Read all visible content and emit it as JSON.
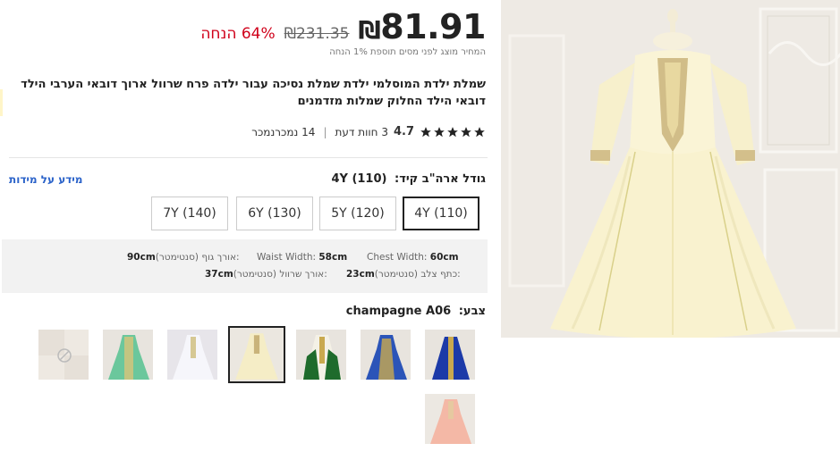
{
  "price": {
    "current": "81.91",
    "currency": "₪",
    "original": "₪231.35",
    "discount": "64% הנחה",
    "tax_note": "המחיר מוצג לפני מסים תוספת 1% הנחה"
  },
  "product": {
    "title": "שמלת ילדת המוסלמי ילדת שמלת נסיכה עבור ילדה פרח שרוול ארוך דובאי הערבי הילד דובאי הילד החלוק שמלות מזדמנים"
  },
  "rating": {
    "score": "4.7",
    "reviews": "3 חוות דעת",
    "sold": "14 נמכרנמכר",
    "stars": 5
  },
  "size": {
    "label": "גודל ארה\"ב קיד:",
    "selected": "4Y (110)",
    "info_link": "מידע על מידות",
    "options": [
      "4Y (110)",
      "5Y (120)",
      "6Y (130)",
      "7Y (140)"
    ]
  },
  "measurements": {
    "chest_label": "Chest Width:",
    "chest_value": "60cm",
    "waist_label": "Waist Width:",
    "waist_value": "58cm",
    "body_length_label": "אורך גוף (סנטימטר):",
    "body_length_value": "90cm",
    "shoulder_label": "כתף צלב (סנטימטר):",
    "shoulder_value": "23cm",
    "sleeve_label": "אורך שרוול (סנטימטר):",
    "sleeve_value": "37cm"
  },
  "color": {
    "label": "צבע:",
    "selected": "champagne A06",
    "swatches": [
      {
        "name": "royal-blue",
        "color": "#1c3aa8"
      },
      {
        "name": "blue-gold",
        "color": "#2b54b8"
      },
      {
        "name": "green-white",
        "color": "#1e6b2c"
      },
      {
        "name": "champagne",
        "color": "#efe6bd"
      },
      {
        "name": "white",
        "color": "#ececf2"
      },
      {
        "name": "mint-green",
        "color": "#6bc79c"
      },
      {
        "name": "unavailable",
        "color": "#e9e3dc"
      },
      {
        "name": "pink",
        "color": "#f4b8a6"
      }
    ]
  },
  "colors": {
    "accent_red": "#d0021b",
    "link_blue": "#2a62c9"
  }
}
